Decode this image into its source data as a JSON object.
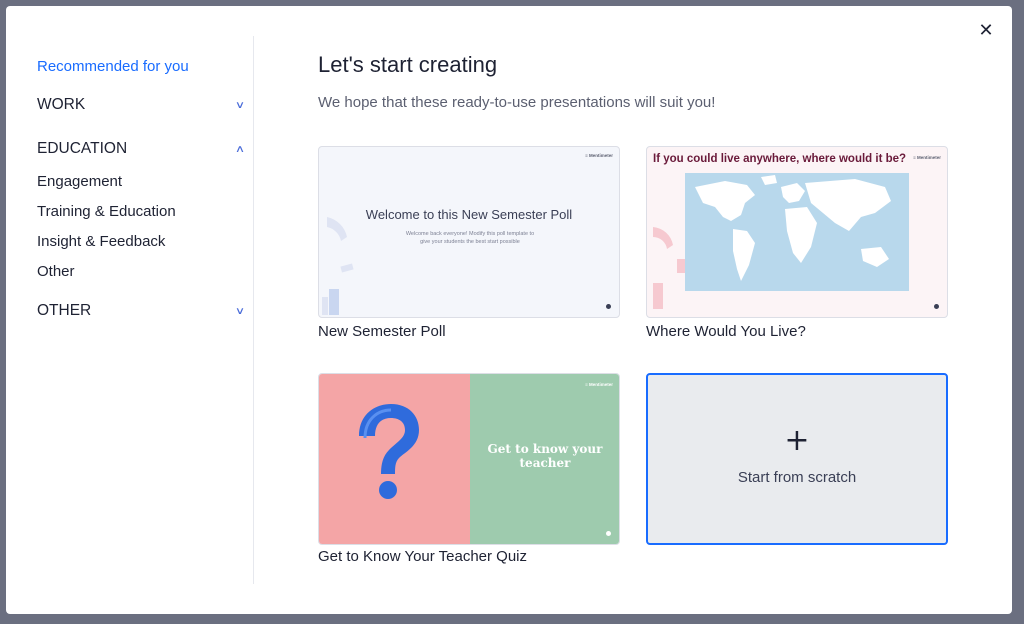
{
  "close": {
    "icon": "close-icon",
    "glyph": "✕"
  },
  "sidebar": {
    "recommended": "Recommended for you",
    "work": {
      "label": "WORK",
      "chevron": "∨"
    },
    "education": {
      "label": "EDUCATION",
      "chevron": "∧",
      "items": [
        "Engagement",
        "Training & Education",
        "Insight & Feedback",
        "Other"
      ]
    },
    "other": {
      "label": "OTHER",
      "chevron": "∨"
    }
  },
  "main": {
    "title": "Let's start creating",
    "subtitle": "We hope that these ready-to-use presentations will suit you!",
    "cards": [
      {
        "label": "New Semester Poll",
        "thumb_title": "Welcome to this New Semester Poll",
        "thumb_desc": "Welcome back everyone! Modify this poll template to give your students the best start possible",
        "thumb_logo": "≡ Mentimeter"
      },
      {
        "label": "Where Would You Live?",
        "thumb_title": "If you could live anywhere, where would it be?",
        "thumb_logo": "≡ Mentimeter"
      },
      {
        "label": "Get to Know Your Teacher Quiz",
        "thumb_title": "Get to know your teacher",
        "thumb_logo": "≡ Mentimeter"
      }
    ],
    "scratch": {
      "plus": "+",
      "label": "Start from scratch"
    }
  },
  "colors": {
    "accent": "#196cff",
    "text": "#1e2233",
    "muted": "#5b5f70",
    "backdrop": "#6b6f80"
  }
}
